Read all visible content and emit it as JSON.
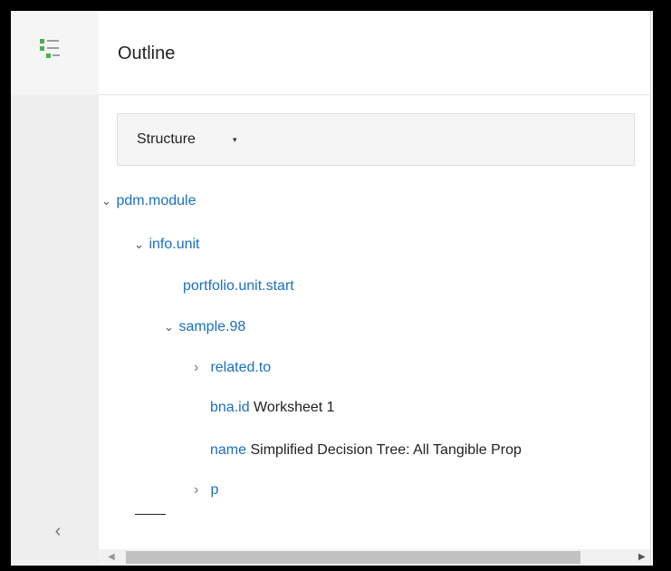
{
  "panel": {
    "title": "Outline",
    "structure_label": "Structure",
    "structure_caret": "▾"
  },
  "icons": {
    "collapse": "‹",
    "chevron_down": "⌄",
    "chevron_right": "›",
    "scroll_left": "◀",
    "scroll_right": "▶"
  },
  "tree": {
    "pdm_module": "pdm.module",
    "info_unit": "info.unit",
    "portfolio_unit_start": "portfolio.unit.start",
    "sample_98": "sample.98",
    "related_to": "related.to",
    "bna_id_key": "bna.id",
    "bna_id_value": "Worksheet 1",
    "name_key": "name",
    "name_value": "Simplified Decision Tree: All Tangible Prop",
    "p": "p"
  },
  "colors": {
    "accent_green": "#4caf50",
    "link_blue": "#1a6fc1"
  }
}
